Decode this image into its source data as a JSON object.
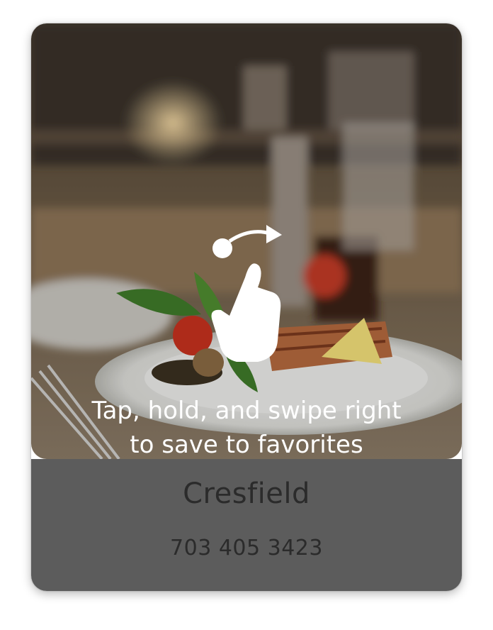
{
  "card": {
    "onboarding_hint": {
      "line1": "Tap, hold, and swipe right",
      "line2": "to save to favorites",
      "icon": "swipe-right-gesture-icon"
    },
    "restaurant": {
      "name": "Cresfield",
      "phone": "703 405 3423"
    },
    "photo": "restaurant-dish-photo"
  },
  "colors": {
    "info_panel": "#5c5c5c",
    "info_text": "#2b2b2b",
    "hint_text": "#ffffff"
  }
}
